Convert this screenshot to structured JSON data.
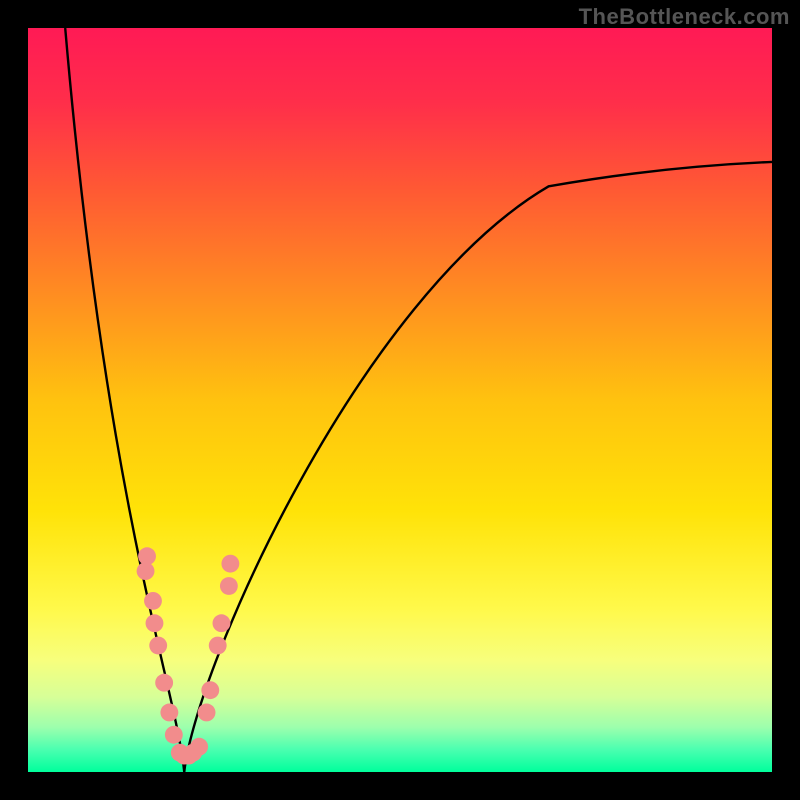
{
  "watermark": "TheBottleneck.com",
  "gradient": {
    "stops": [
      {
        "offset": 0.0,
        "color": "#ff1a55"
      },
      {
        "offset": 0.1,
        "color": "#ff2e4a"
      },
      {
        "offset": 0.22,
        "color": "#ff5a33"
      },
      {
        "offset": 0.35,
        "color": "#ff8a22"
      },
      {
        "offset": 0.5,
        "color": "#ffc20f"
      },
      {
        "offset": 0.65,
        "color": "#ffe308"
      },
      {
        "offset": 0.78,
        "color": "#fff94a"
      },
      {
        "offset": 0.85,
        "color": "#f7ff7d"
      },
      {
        "offset": 0.9,
        "color": "#d6ff98"
      },
      {
        "offset": 0.94,
        "color": "#9cffad"
      },
      {
        "offset": 0.97,
        "color": "#4affb0"
      },
      {
        "offset": 1.0,
        "color": "#00ff9c"
      }
    ]
  },
  "curve": {
    "x_range": [
      0,
      100
    ],
    "y_range": [
      0,
      100
    ],
    "minimum_at_x": 21,
    "left_start": {
      "x": 5,
      "y": 100
    },
    "right_end": {
      "x": 100,
      "y": 82
    }
  },
  "markers": {
    "color": "#f28c8c",
    "radius": 1.2,
    "points_left": [
      {
        "x": 16.0,
        "y": 29
      },
      {
        "x": 15.8,
        "y": 27
      },
      {
        "x": 16.8,
        "y": 23
      },
      {
        "x": 17.0,
        "y": 20
      },
      {
        "x": 17.5,
        "y": 17
      },
      {
        "x": 18.3,
        "y": 12
      },
      {
        "x": 19.0,
        "y": 8
      },
      {
        "x": 19.6,
        "y": 5
      }
    ],
    "points_bottom": [
      {
        "x": 20.4,
        "y": 2.6
      },
      {
        "x": 21.0,
        "y": 2.2
      },
      {
        "x": 21.6,
        "y": 2.2
      },
      {
        "x": 22.2,
        "y": 2.6
      },
      {
        "x": 23.0,
        "y": 3.4
      }
    ],
    "points_right": [
      {
        "x": 24.0,
        "y": 8
      },
      {
        "x": 24.5,
        "y": 11
      },
      {
        "x": 25.5,
        "y": 17
      },
      {
        "x": 26.0,
        "y": 20
      },
      {
        "x": 27.0,
        "y": 25
      },
      {
        "x": 27.2,
        "y": 28
      }
    ]
  },
  "chart_data": {
    "type": "line",
    "title": "",
    "xlabel": "",
    "ylabel": "",
    "xlim": [
      0,
      100
    ],
    "ylim": [
      0,
      100
    ],
    "series": [
      {
        "name": "bottleneck-curve",
        "x": [
          5,
          8,
          11,
          14,
          17,
          19,
          21,
          23,
          26,
          30,
          36,
          44,
          54,
          66,
          80,
          100
        ],
        "y": [
          100,
          80,
          60,
          42,
          25,
          10,
          0,
          9,
          24,
          38,
          50,
          60,
          68,
          74,
          78,
          82
        ]
      }
    ],
    "scatter": [
      {
        "name": "highlighted-region",
        "color": "#f28c8c",
        "points": [
          [
            16.0,
            29
          ],
          [
            15.8,
            27
          ],
          [
            16.8,
            23
          ],
          [
            17.0,
            20
          ],
          [
            17.5,
            17
          ],
          [
            18.3,
            12
          ],
          [
            19.0,
            8
          ],
          [
            19.6,
            5
          ],
          [
            20.4,
            2.6
          ],
          [
            21.0,
            2.2
          ],
          [
            21.6,
            2.2
          ],
          [
            22.2,
            2.6
          ],
          [
            23.0,
            3.4
          ],
          [
            24.0,
            8
          ],
          [
            24.5,
            11
          ],
          [
            25.5,
            17
          ],
          [
            26.0,
            20
          ],
          [
            27.0,
            25
          ],
          [
            27.2,
            28
          ]
        ]
      }
    ],
    "background_gradient": "vertical red→yellow→green",
    "watermark": "TheBottleneck.com"
  }
}
